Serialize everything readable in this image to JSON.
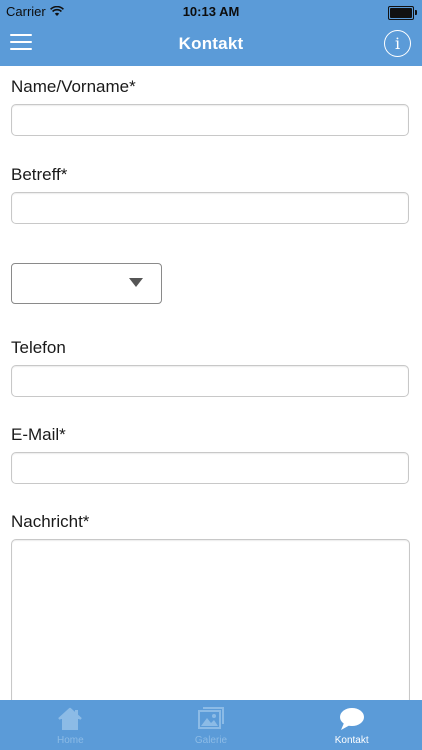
{
  "status_bar": {
    "carrier": "Carrier",
    "time": "10:13 AM"
  },
  "nav": {
    "title": "Kontakt",
    "info_glyph": "i",
    "icons": [
      "menu-icon",
      "info-icon"
    ]
  },
  "form": {
    "name_label": "Name/Vorname*",
    "name_value": "",
    "subject_label": "Betreff*",
    "subject_value": "",
    "select_value": "",
    "phone_label": "Telefon",
    "phone_value": "",
    "email_label": "E-Mail*",
    "email_value": "",
    "message_label": "Nachricht*",
    "message_value": ""
  },
  "tab_bar": {
    "tabs": [
      {
        "label": "Home",
        "icon": "home-icon",
        "active": false
      },
      {
        "label": "Galerie",
        "icon": "gallery-icon",
        "active": false
      },
      {
        "label": "Kontakt",
        "icon": "chat-bubble-icon",
        "active": true
      }
    ]
  },
  "colors": {
    "primary": "#5b9bd8",
    "tab_inactive": "#8cbbe6",
    "tab_active": "#ffffff"
  }
}
